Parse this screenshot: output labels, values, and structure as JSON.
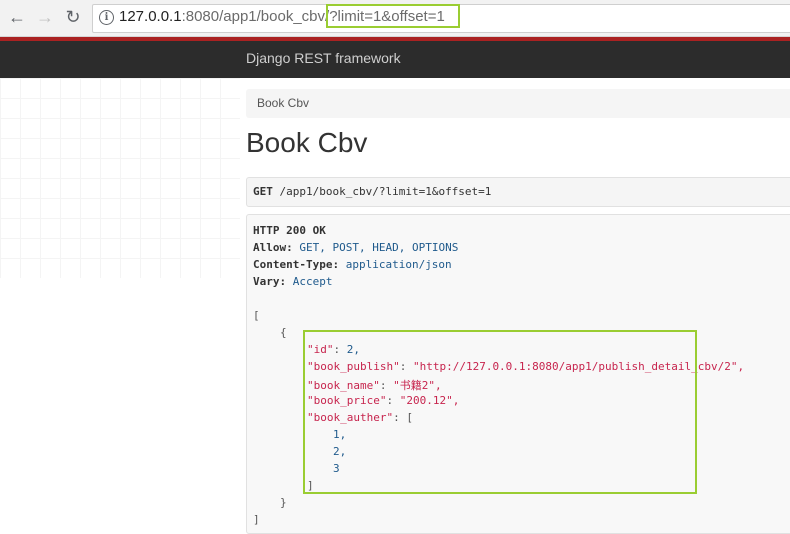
{
  "browser": {
    "url_host": "127.0.0.1",
    "url_port_path": ":8080/app1/book_cbv/",
    "url_query": "?limit=1&offset=1"
  },
  "navbar": {
    "brand": "Django REST framework"
  },
  "breadcrumb": {
    "item": "Book Cbv"
  },
  "page": {
    "title": "Book Cbv"
  },
  "request": {
    "method": "GET",
    "path": "/app1/book_cbv/?limit=1&offset=1"
  },
  "response": {
    "status_line": "HTTP 200 OK",
    "headers": [
      {
        "name": "Allow:",
        "value": "GET, POST, HEAD, OPTIONS"
      },
      {
        "name": "Content-Type:",
        "value": "application/json"
      },
      {
        "name": "Vary:",
        "value": "Accept"
      }
    ],
    "body": {
      "open_bracket": "[",
      "open_brace": "{",
      "fields": [
        {
          "key": "\"id\"",
          "value": "2,"
        },
        {
          "key": "\"book_publish\"",
          "value": "\"http://127.0.0.1:8080/app1/publish_detail_cbv/2\","
        },
        {
          "key": "\"book_name\"",
          "value": "\"书籍2\","
        },
        {
          "key": "\"book_price\"",
          "value": "\"200.12\","
        },
        {
          "key": "\"book_auther\"",
          "value": "["
        }
      ],
      "auther_items": [
        "1,",
        "2,",
        "3"
      ],
      "close_list": "]",
      "close_brace": "}",
      "close_bracket": "]"
    }
  }
}
